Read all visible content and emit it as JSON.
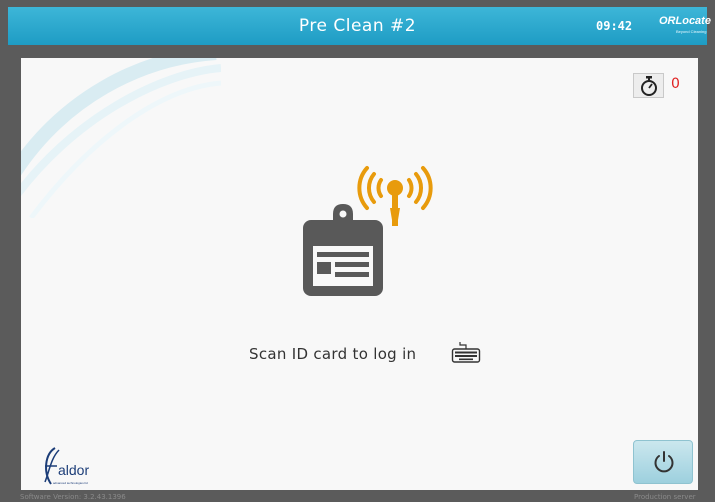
{
  "header": {
    "title": "Pre Clean #2",
    "time": "09:42",
    "brand": "ORLocate",
    "brand_tagline": "Beyond Cleaning"
  },
  "panel": {
    "timer_count": "0",
    "login_prompt": "Scan ID card to log in",
    "icons": [
      "timer-icon",
      "id-card-icon",
      "rfid-signal-icon",
      "keyboard-icon",
      "power-icon"
    ]
  },
  "logo": {
    "name": "aldor",
    "tagline": "advanced technologies ltd"
  },
  "footer": {
    "version": "Software Version: 3.2.43.1396",
    "mode": "Production server"
  },
  "colors": {
    "header": "#1e9cc4",
    "accent": "#e89b0c",
    "card": "#595959",
    "timer_count": "#e02020",
    "logo": "#1c3d78"
  }
}
